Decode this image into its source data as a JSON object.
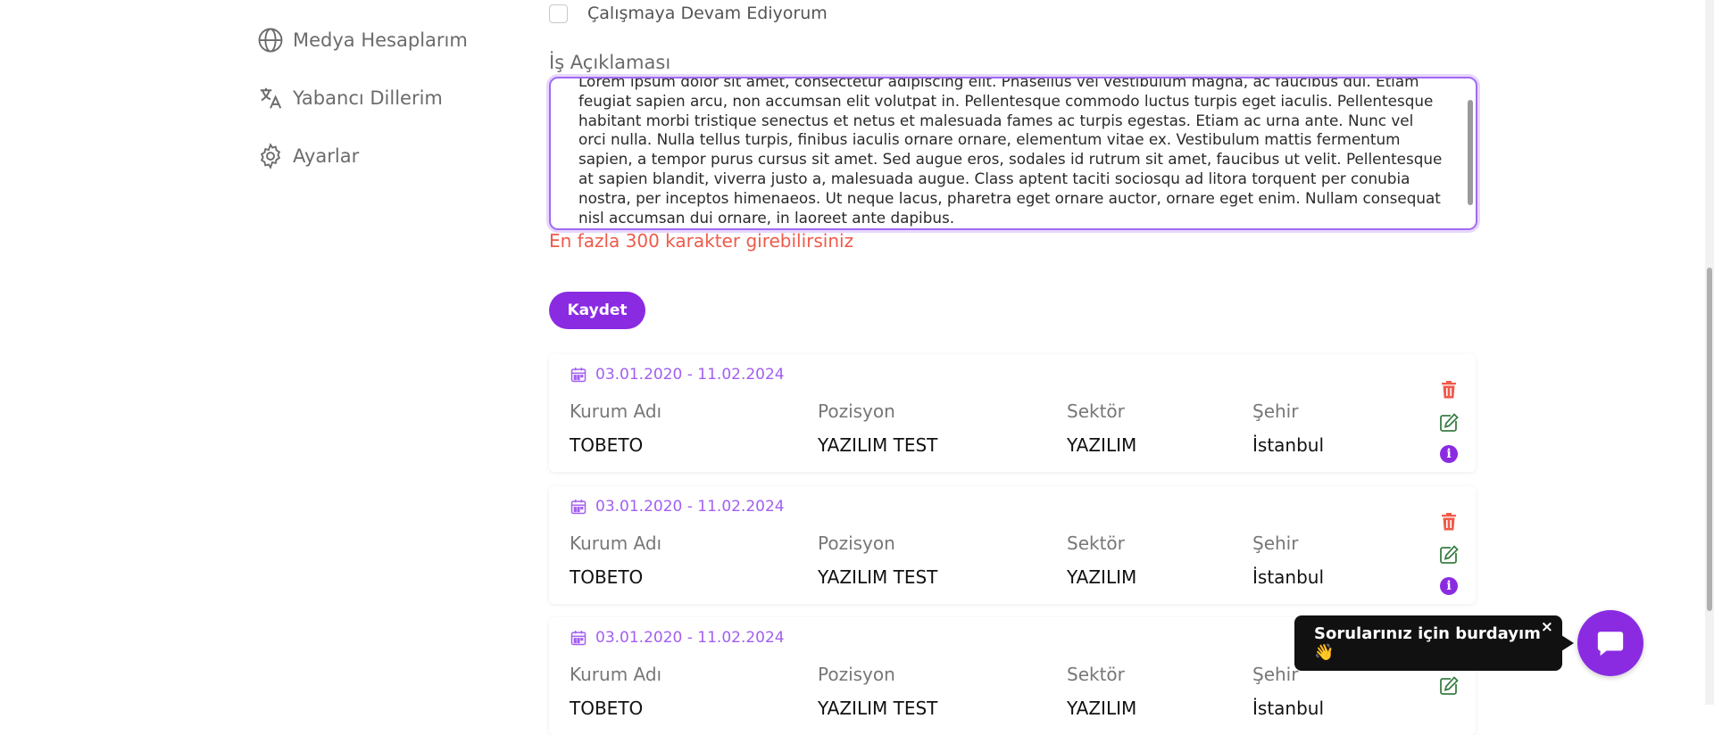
{
  "sidebar": {
    "items": [
      {
        "label": "Medya Hesaplarım",
        "icon": "globe-icon"
      },
      {
        "label": "Yabancı Dillerim",
        "icon": "translate-icon"
      },
      {
        "label": "Ayarlar",
        "icon": "gear-icon"
      }
    ]
  },
  "form": {
    "still_working_label": "Çalışmaya Devam Ediyorum",
    "still_working_checked": false,
    "description_label": "İş Açıklaması",
    "description_value": "Lorem ipsum dolor sit amet, consectetur adipiscing elit. Phasellus vel vestibulum magna, ac faucibus dui. Etiam feugiat sapien arcu, non accumsan elit volutpat in. Pellentesque commodo luctus turpis eget iaculis. Pellentesque habitant morbi tristique senectus et netus et malesuada fames ac turpis egestas. Etiam ac urna ante. Nunc vel orci nulla. Nulla tellus turpis, finibus iaculis ornare ornare, elementum vitae ex. Vestibulum mattis fermentum sapien, a tempor purus cursus sit amet. Sed augue eros, sodales id rutrum sit amet, faucibus ut velit. Pellentesque at sapien blandit, viverra justo a, malesuada augue. Class aptent taciti sociosqu ad litora torquent per conubia nostra, per inceptos himenaeos. Ut neque lacus, pharetra eget ornare auctor, ornare eget enim. Nullam consequat nisl accumsan dui ornare, in laoreet ante dapibus.",
    "error": "En fazla 300 karakter girebilirsiniz",
    "save_label": "Kaydet"
  },
  "experiences": [
    {
      "date": "03.01.2020 - 11.02.2024",
      "company_label": "Kurum Adı",
      "company": "TOBETO",
      "position_label": "Pozisyon",
      "position": "YAZILIM TEST",
      "sector_label": "Sektör",
      "sector": "YAZILIM",
      "city_label": "Şehir",
      "city": "İstanbul"
    },
    {
      "date": "03.01.2020 - 11.02.2024",
      "company_label": "Kurum Adı",
      "company": "TOBETO",
      "position_label": "Pozisyon",
      "position": "YAZILIM TEST",
      "sector_label": "Sektör",
      "sector": "YAZILIM",
      "city_label": "Şehir",
      "city": "İstanbul"
    },
    {
      "date": "03.01.2020 - 11.02.2024",
      "company_label": "Kurum Adı",
      "company": "TOBETO",
      "position_label": "Pozisyon",
      "position": "YAZILIM TEST",
      "sector_label": "Sektör",
      "sector": "YAZILIM",
      "city_label": "Şehir",
      "city": "İstanbul"
    }
  ],
  "chat": {
    "message": "Sorularınız için burdayım 👋",
    "close_symbol": "×"
  },
  "colors": {
    "accent": "#8a2be2",
    "date": "#a25ff0",
    "error": "#ef5a4a",
    "delete": "#ef5a4a",
    "edit": "#3a7d44"
  }
}
